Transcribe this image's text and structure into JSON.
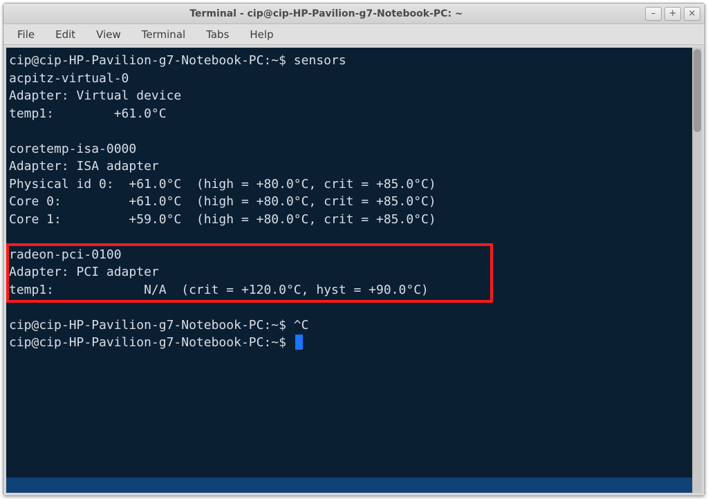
{
  "window": {
    "title": "Terminal - cip@cip-HP-Pavilion-g7-Notebook-PC: ~",
    "controls": {
      "minimize": "–",
      "maximize": "+",
      "close": "×"
    }
  },
  "menubar": {
    "items": [
      "File",
      "Edit",
      "View",
      "Terminal",
      "Tabs",
      "Help"
    ]
  },
  "terminal": {
    "prompt": "cip@cip-HP-Pavilion-g7-Notebook-PC:~$ ",
    "command": "sensors",
    "lines": [
      "cip@cip-HP-Pavilion-g7-Notebook-PC:~$ sensors",
      "acpitz-virtual-0",
      "Adapter: Virtual device",
      "temp1:        +61.0°C",
      "",
      "coretemp-isa-0000",
      "Adapter: ISA adapter",
      "Physical id 0:  +61.0°C  (high = +80.0°C, crit = +85.0°C)",
      "Core 0:         +61.0°C  (high = +80.0°C, crit = +85.0°C)",
      "Core 1:         +59.0°C  (high = +80.0°C, crit = +85.0°C)",
      "",
      "radeon-pci-0100",
      "Adapter: PCI adapter",
      "temp1:            N/A  (crit = +120.0°C, hyst = +90.0°C)",
      "",
      "cip@cip-HP-Pavilion-g7-Notebook-PC:~$ ^C",
      "cip@cip-HP-Pavilion-g7-Notebook-PC:~$ "
    ],
    "interrupt": "^C"
  },
  "highlight_region": {
    "description": "radeon-pci-0100 section highlighted with red rectangle",
    "first_line_index": 11,
    "last_line_index": 13
  }
}
